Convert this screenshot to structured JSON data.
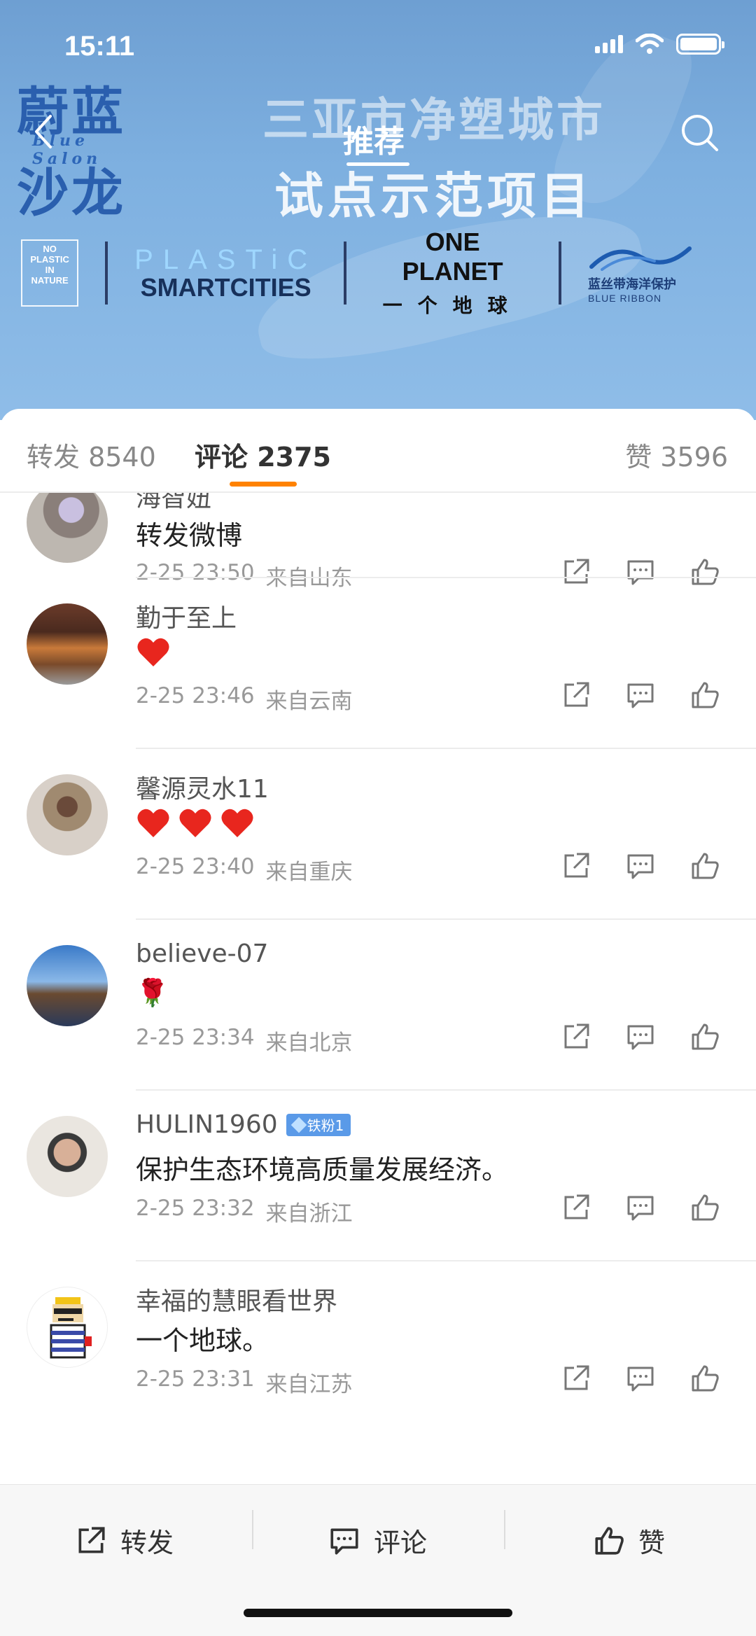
{
  "status_bar": {
    "time": "15:11"
  },
  "header": {
    "brand_big_1": "蔚蓝",
    "brand_sub": "Blue Salon",
    "brand_big_2": "沙龙",
    "headline_line1": "三亚市净塑城市",
    "headline_line2": "试点示范项目",
    "nav_title": "推荐",
    "partners": {
      "p1_lines": [
        "NO",
        "PLASTIC",
        "IN",
        "NATURE"
      ],
      "p2_top": "PLASTiC",
      "p2_bottom": "SMARTCITIES",
      "p3_top": "ONE PLANET",
      "p3_bottom": "一个地球",
      "p4_top": "蓝丝带海洋保护",
      "p4_bottom": "BLUE RIBBON"
    }
  },
  "tabs": {
    "repost_label": "转发 8540",
    "comment_label": "评论 2375",
    "like_label": "赞 3596"
  },
  "comments": [
    {
      "name": "海智妞",
      "text": "转发微博",
      "date": "2-25 23:50",
      "location": "来自山东"
    },
    {
      "name": "勤于至上",
      "text": "",
      "hearts": 1,
      "date": "2-25 23:46",
      "location": "来自云南"
    },
    {
      "name": "馨源灵水11",
      "text": "",
      "hearts": 3,
      "date": "2-25 23:40",
      "location": "来自重庆"
    },
    {
      "name": "believe-07",
      "text": "🌹",
      "date": "2-25 23:34",
      "location": "来自北京"
    },
    {
      "name": "HULIN1960",
      "badge": "铁粉1",
      "text": "保护生态环境高质量发展经济。",
      "date": "2-25 23:32",
      "location": "来自浙江"
    },
    {
      "name": "幸福的慧眼看世界",
      "text": "一个地球。",
      "date": "2-25 23:31",
      "location": "来自江苏"
    }
  ],
  "bottom_bar": {
    "repost": "转发",
    "comment": "评论",
    "like": "赞"
  },
  "colors": {
    "accent": "#ff8200",
    "banner_blue": "#7eb0e0",
    "heart_red": "#e8261e",
    "badge_blue": "#5a9ae8"
  }
}
